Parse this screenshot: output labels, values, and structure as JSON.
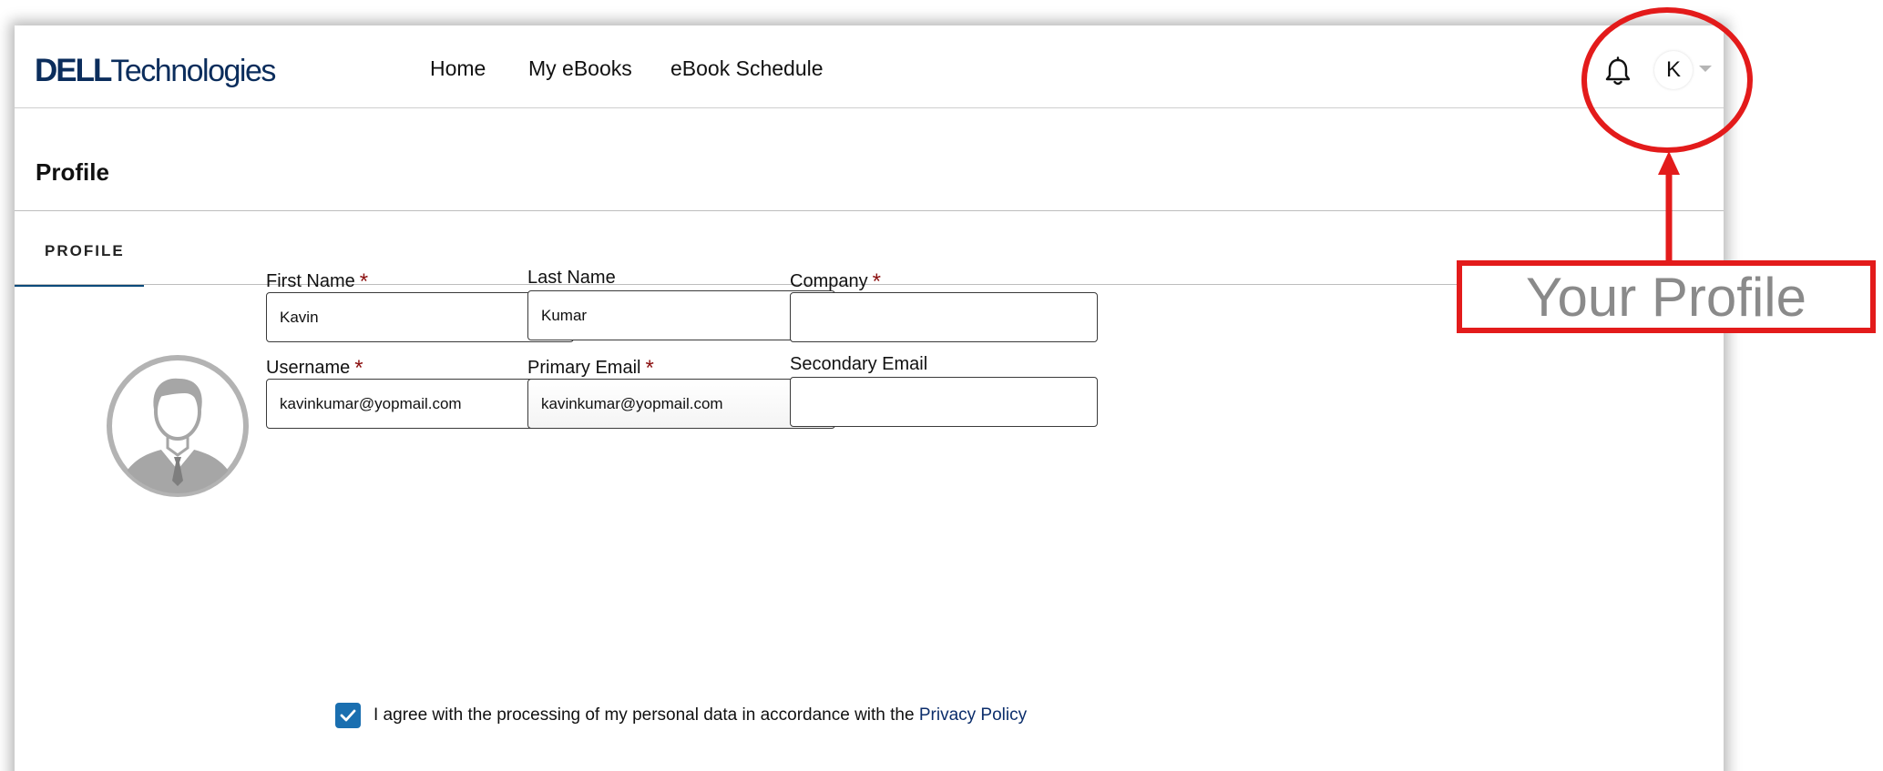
{
  "header": {
    "brand_bold": "DELL",
    "brand_light": "Technologies",
    "nav": {
      "home": "Home",
      "my_ebooks": "My eBooks",
      "ebook_schedule": "eBook Schedule"
    },
    "user_initial": "K"
  },
  "page": {
    "title": "Profile",
    "tab_label": "PROFILE"
  },
  "form": {
    "first_name": {
      "label": "First Name",
      "required_mark": "*",
      "value": "Kavin"
    },
    "last_name": {
      "label": "Last Name",
      "value": "Kumar"
    },
    "company": {
      "label": "Company",
      "required_mark": "*",
      "value": ""
    },
    "username": {
      "label": "Username",
      "required_mark": "*",
      "value": "kavinkumar@yopmail.com"
    },
    "primary_email": {
      "label": "Primary Email",
      "required_mark": "*",
      "value": "kavinkumar@yopmail.com"
    },
    "secondary_email": {
      "label": "Secondary Email",
      "value": ""
    }
  },
  "consent": {
    "text": "I agree with the processing of my personal data in accordance with the ",
    "link": "Privacy Policy",
    "checked": true
  },
  "annotation": {
    "label": "Your Profile",
    "color": "#e31b1b"
  },
  "colors": {
    "brand": "#0b2d5c",
    "tab_underline": "#0b4a7a",
    "required": "#8b1010",
    "checkbox": "#1a6fb0"
  }
}
